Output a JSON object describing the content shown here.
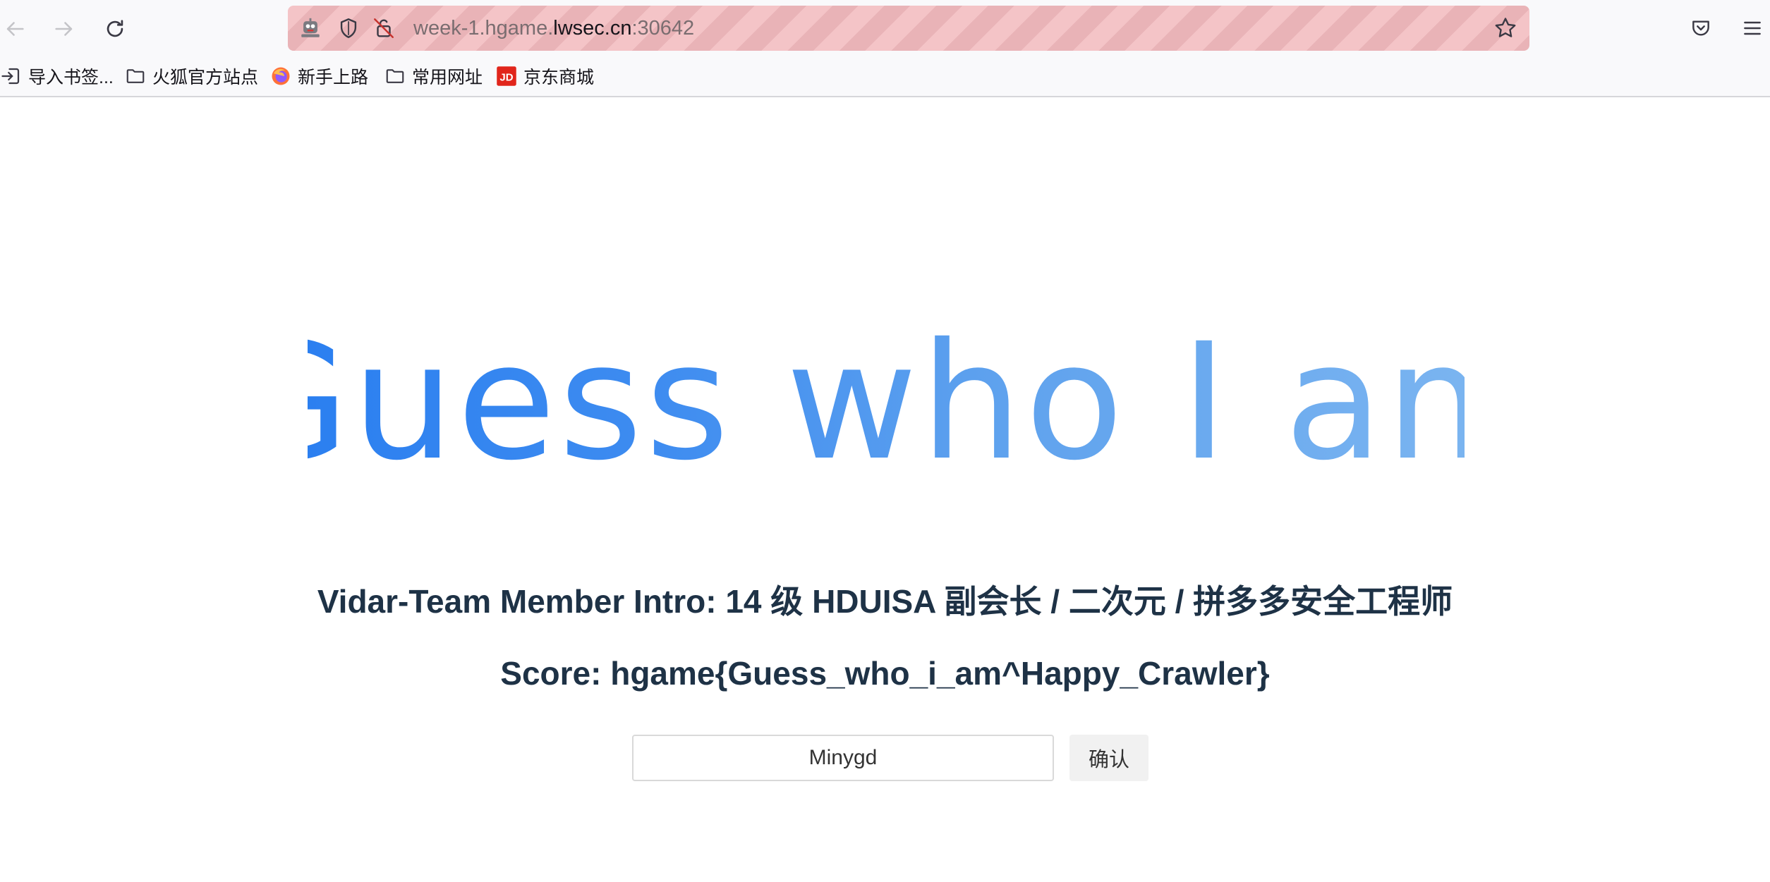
{
  "browser": {
    "url": {
      "prefix": "week-1.hgame.",
      "domain": "lwsec.cn",
      "suffix": ":30642"
    },
    "icons": {
      "back": "back-arrow-icon",
      "forward": "forward-arrow-icon",
      "reload": "reload-icon",
      "remote": "remote-control-robot-icon",
      "shield": "tracking-protection-shield-icon",
      "insecure": "insecure-lock-icon",
      "bookmark_star": "star-icon",
      "pocket": "pocket-icon",
      "menu": "hamburger-menu-icon"
    },
    "bookmarks": [
      {
        "label": "导入书签...",
        "icon": "import-icon"
      },
      {
        "label": "火狐官方站点",
        "icon": "folder-icon"
      },
      {
        "label": "新手上路",
        "icon": "firefox-icon"
      },
      {
        "label": "常用网址",
        "icon": "folder-icon"
      },
      {
        "label": "京东商城",
        "icon": "jd-icon"
      }
    ],
    "colors": {
      "urlbar_stripe_a": "#f4c4c7",
      "urlbar_stripe_b": "#e9b3b7",
      "jd_red": "#e1251b"
    }
  },
  "page": {
    "title": "Guess who I am",
    "intro": "Vidar-Team Member Intro: 14 级 HDUISA 副会长 / 二次元 / 拼多多安全工程师",
    "score": "Score: hgame{Guess_who_i_am^Happy_Crawler}",
    "input_value": "Minygd",
    "confirm_label": "确认",
    "colors": {
      "title_start": "#2b7ff0",
      "title_end": "#7ab4f0",
      "text": "#1e3246"
    }
  }
}
